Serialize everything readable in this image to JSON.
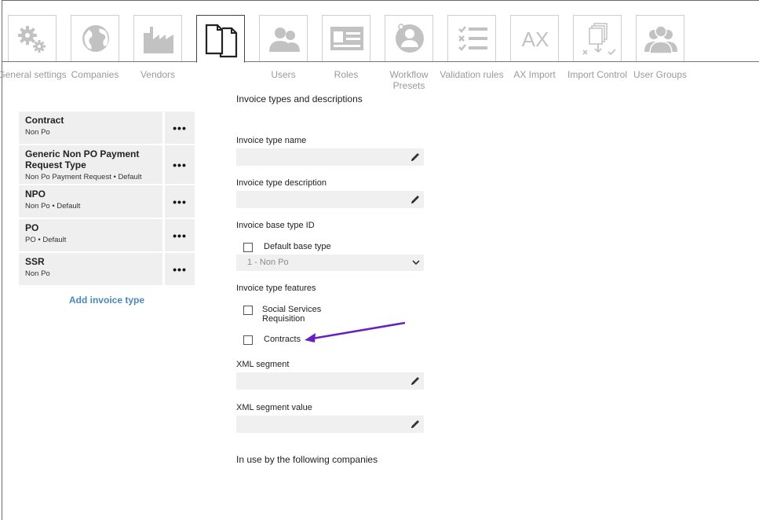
{
  "tabs": [
    {
      "id": "general",
      "label": "General settings",
      "icon": "gears-icon"
    },
    {
      "id": "companies",
      "label": "Companies",
      "icon": "globe-icon"
    },
    {
      "id": "vendors",
      "label": "Vendors",
      "icon": "factory-icon"
    },
    {
      "id": "invoice-types",
      "label": "",
      "icon": "documents-icon",
      "active": true
    },
    {
      "id": "users",
      "label": "Users",
      "icon": "users-icon"
    },
    {
      "id": "roles",
      "label": "Roles",
      "icon": "id-card-icon"
    },
    {
      "id": "workflow",
      "label": "Workflow Presets",
      "icon": "person-circle-icon"
    },
    {
      "id": "validation",
      "label": "Validation rules",
      "icon": "checklist-icon"
    },
    {
      "id": "ax",
      "label": "AX Import",
      "icon": "ax-icon"
    },
    {
      "id": "import",
      "label": "Import Control",
      "icon": "import-control-icon"
    },
    {
      "id": "groups",
      "label": "User Groups",
      "icon": "user-group-icon"
    }
  ],
  "invoice_types": [
    {
      "name": "Contract",
      "sub": "Non Po"
    },
    {
      "name": "Generic Non PO Payment Request Type",
      "sub": "Non Po Payment Request • Default"
    },
    {
      "name": "NPO",
      "sub": "Non Po • Default"
    },
    {
      "name": "PO",
      "sub": "PO • Default"
    },
    {
      "name": "SSR",
      "sub": "Non Po"
    }
  ],
  "more_label": "•••",
  "add_invoice_type": "Add invoice type",
  "form": {
    "title": "Invoice types and descriptions",
    "type_name_label": "Invoice type name",
    "type_name_value": "",
    "type_desc_label": "Invoice type description",
    "type_desc_value": "",
    "base_type_label": "Invoice base type ID",
    "default_base_type": "Default base type",
    "base_type_selected": "1 - Non Po",
    "features_label": "Invoice type features",
    "feature_ssr": "Social Services Requisition",
    "feature_contracts": "Contracts",
    "xml_segment_label": "XML segment",
    "xml_segment_value": "",
    "xml_segment_value_label": "XML segment value",
    "xml_segment_value_value": "",
    "in_use_label": "In use by the following companies"
  },
  "colors": {
    "accent": "#4a88b8",
    "arrow": "#6a1fc2",
    "icon": "#c2c2c2"
  }
}
